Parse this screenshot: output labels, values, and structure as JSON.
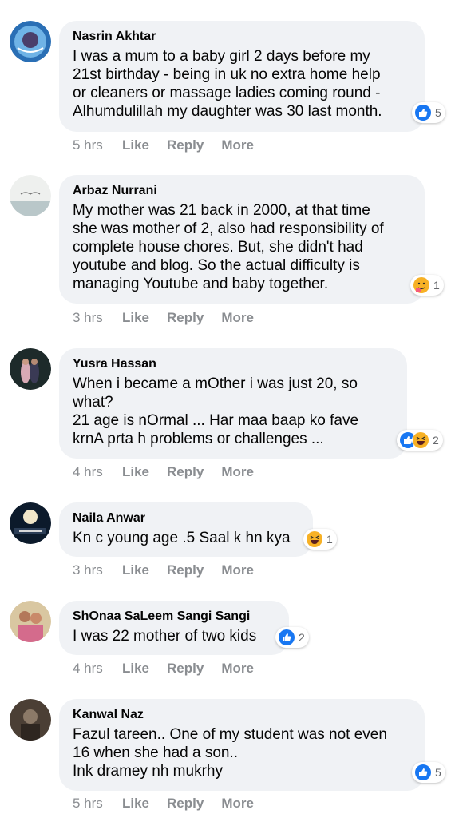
{
  "comments": [
    {
      "author": "Nasrin Akhtar",
      "text": "I was a mum to a baby girl 2 days before my\n21st birthday - being in uk no extra home help\nor cleaners or massage ladies coming round -\nAlhumdulillah my daughter was 30 last month.",
      "reactions": [
        "like"
      ],
      "reaction_count": "5",
      "time": "5 hrs",
      "like_label": "Like",
      "reply_label": "Reply",
      "more_label": "More"
    },
    {
      "author": "Arbaz Nurrani",
      "text": "My mother was 21 back in 2000, at that time\nshe was mother of 2, also had responsibility of\ncomplete house chores. But, she didn't had\nyoutube and blog. So the actual difficulty is\nmanaging Youtube and baby together.",
      "reactions": [
        "care"
      ],
      "reaction_count": "1",
      "time": "3 hrs",
      "like_label": "Like",
      "reply_label": "Reply",
      "more_label": "More"
    },
    {
      "author": "Yusra Hassan",
      "text": "When i became a mOther i was just 20, so\nwhat?\n21 age is nOrmal ... Har maa baap ko fave\nkrnA prta h problems or challenges ...",
      "reactions": [
        "like",
        "haha"
      ],
      "reaction_count": "2",
      "time": "4 hrs",
      "like_label": "Like",
      "reply_label": "Reply",
      "more_label": "More"
    },
    {
      "author": "Naila Anwar",
      "text": "Kn c young age .5 Saal k hn kya",
      "reactions": [
        "haha"
      ],
      "reaction_count": "1",
      "time": "3 hrs",
      "like_label": "Like",
      "reply_label": "Reply",
      "more_label": "More"
    },
    {
      "author": "ShOnaa SaLeem Sangi Sangi",
      "text": "I was 22 mother of two kids",
      "reactions": [
        "like"
      ],
      "reaction_count": "2",
      "time": "4 hrs",
      "like_label": "Like",
      "reply_label": "Reply",
      "more_label": "More"
    },
    {
      "author": "Kanwal Naz",
      "text": "Fazul tareen.. One of my student was not even\n16 when she had a son..\nInk dramey nh mukrhy",
      "reactions": [
        "like"
      ],
      "reaction_count": "5",
      "time": "5 hrs",
      "like_label": "Like",
      "reply_label": "Reply",
      "more_label": "More"
    }
  ],
  "colors": {
    "bubble": "#f0f2f5",
    "like_blue": "#1877f2",
    "meta_gray": "#8a8d91",
    "emoji_yellow": "#f7b125"
  }
}
